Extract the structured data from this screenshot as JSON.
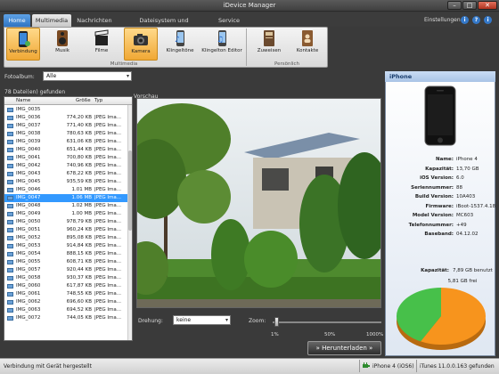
{
  "window": {
    "title": "iDevice Manager"
  },
  "tabs": [
    {
      "label": "Home"
    },
    {
      "label": "Multimedia"
    },
    {
      "label": "Nachrichten"
    },
    {
      "label": "Dateisystem und Datenträger"
    },
    {
      "label": "Service"
    }
  ],
  "header": {
    "settings_label": "Einstellungen",
    "info_glyph": "i",
    "help_glyph": "?",
    "extra_glyph": "i"
  },
  "ribbon": {
    "buttons": [
      {
        "label": "Verbindung",
        "icon": "phone-connect-icon"
      },
      {
        "label": "Musik",
        "icon": "speaker-icon"
      },
      {
        "label": "Filme",
        "icon": "clapperboard-icon"
      },
      {
        "label": "Kamera",
        "icon": "camera-icon"
      },
      {
        "label": "Klingeltöne",
        "icon": "ringtone-icon"
      },
      {
        "label": "Klingelton Editor",
        "icon": "ringtone-editor-icon"
      },
      {
        "label": "Zuweisen",
        "icon": "assign-icon"
      },
      {
        "label": "Kontakte",
        "icon": "contacts-icon"
      }
    ],
    "group_multimedia": "Multimedia",
    "group_personal": "Persönlich"
  },
  "album": {
    "label": "Fotoalbum:",
    "value": "Alle"
  },
  "files": {
    "count_label": "78 Datei(en) gefunden",
    "columns": {
      "name": "Name",
      "size": "Größe",
      "type": "Typ"
    },
    "rows": [
      {
        "name": "IMG_0035",
        "size": "",
        "type": ""
      },
      {
        "name": "IMG_0036",
        "size": "774,20 KB",
        "type": "JPEG Ima..."
      },
      {
        "name": "IMG_0037",
        "size": "771,40 KB",
        "type": "JPEG Ima..."
      },
      {
        "name": "IMG_0038",
        "size": "780,63 KB",
        "type": "JPEG Ima..."
      },
      {
        "name": "IMG_0039",
        "size": "631,06 KB",
        "type": "JPEG Ima..."
      },
      {
        "name": "IMG_0040",
        "size": "651,44 KB",
        "type": "JPEG Ima..."
      },
      {
        "name": "IMG_0041",
        "size": "700,80 KB",
        "type": "JPEG Ima..."
      },
      {
        "name": "IMG_0042",
        "size": "740,96 KB",
        "type": "JPEG Ima..."
      },
      {
        "name": "IMG_0043",
        "size": "678,22 KB",
        "type": "JPEG Ima..."
      },
      {
        "name": "IMG_0045",
        "size": "935,59 KB",
        "type": "JPEG Ima..."
      },
      {
        "name": "IMG_0046",
        "size": "1.01 MB",
        "type": "JPEG Ima..."
      },
      {
        "name": "IMG_0047",
        "size": "1.06 MB",
        "type": "JPEG Ima..."
      },
      {
        "name": "IMG_0048",
        "size": "1.02 MB",
        "type": "JPEG Ima..."
      },
      {
        "name": "IMG_0049",
        "size": "1.00 MB",
        "type": "JPEG Ima..."
      },
      {
        "name": "IMG_0050",
        "size": "978,79 KB",
        "type": "JPEG Ima..."
      },
      {
        "name": "IMG_0051",
        "size": "960,24 KB",
        "type": "JPEG Ima..."
      },
      {
        "name": "IMG_0052",
        "size": "895,08 KB",
        "type": "JPEG Ima..."
      },
      {
        "name": "IMG_0053",
        "size": "914,84 KB",
        "type": "JPEG Ima..."
      },
      {
        "name": "IMG_0054",
        "size": "888,15 KB",
        "type": "JPEG Ima..."
      },
      {
        "name": "IMG_0055",
        "size": "608,71 KB",
        "type": "JPEG Ima..."
      },
      {
        "name": "IMG_0057",
        "size": "920,44 KB",
        "type": "JPEG Ima..."
      },
      {
        "name": "IMG_0058",
        "size": "930,37 KB",
        "type": "JPEG Ima..."
      },
      {
        "name": "IMG_0060",
        "size": "617,87 KB",
        "type": "JPEG Ima..."
      },
      {
        "name": "IMG_0061",
        "size": "748,55 KB",
        "type": "JPEG Ima..."
      },
      {
        "name": "IMG_0062",
        "size": "696,60 KB",
        "type": "JPEG Ima..."
      },
      {
        "name": "IMG_0063",
        "size": "694,52 KB",
        "type": "JPEG Ima..."
      },
      {
        "name": "IMG_0072",
        "size": "744,05 KB",
        "type": "JPEG Ima..."
      }
    ],
    "selected_index": 11
  },
  "preview": {
    "label": "Vorschau",
    "image": "garden-photo"
  },
  "rotation": {
    "label": "Drehung:",
    "value": "keine"
  },
  "zoom": {
    "label": "Zoom:",
    "level": 0.02,
    "ticks": [
      "1%",
      "50%",
      "1000%"
    ]
  },
  "download": {
    "label": "» Herunterladen »"
  },
  "device": {
    "title": "iPhone",
    "fields": [
      {
        "label": "Name:",
        "value": "iPhone 4"
      },
      {
        "label": "Kapazität:",
        "value": "13,70 GB"
      },
      {
        "label": "iOS Version:",
        "value": "6.0"
      },
      {
        "label": "Seriennummer:",
        "value": "88"
      },
      {
        "label": "Build Version:",
        "value": "10A403"
      },
      {
        "label": "Firmware:",
        "value": "iBoot-1537.4.18"
      },
      {
        "label": "Model Version:",
        "value": "MC603"
      },
      {
        "label": "Telefonnummer:",
        "value": "+49"
      },
      {
        "label": "Baseband:",
        "value": "04.12.02"
      }
    ],
    "capacity_label": "Kapazität:",
    "capacity_used": "7,89 GB benutzt",
    "capacity_free": "5,81 GB frei",
    "colors": {
      "used": "#f7941d",
      "free": "#47c04a"
    }
  },
  "status": {
    "text": "Verbindung mit Gerät hergestellt",
    "device": "iPhone 4 (iOS6)",
    "itunes": "iTunes 11.0.0.163 gefunden"
  }
}
